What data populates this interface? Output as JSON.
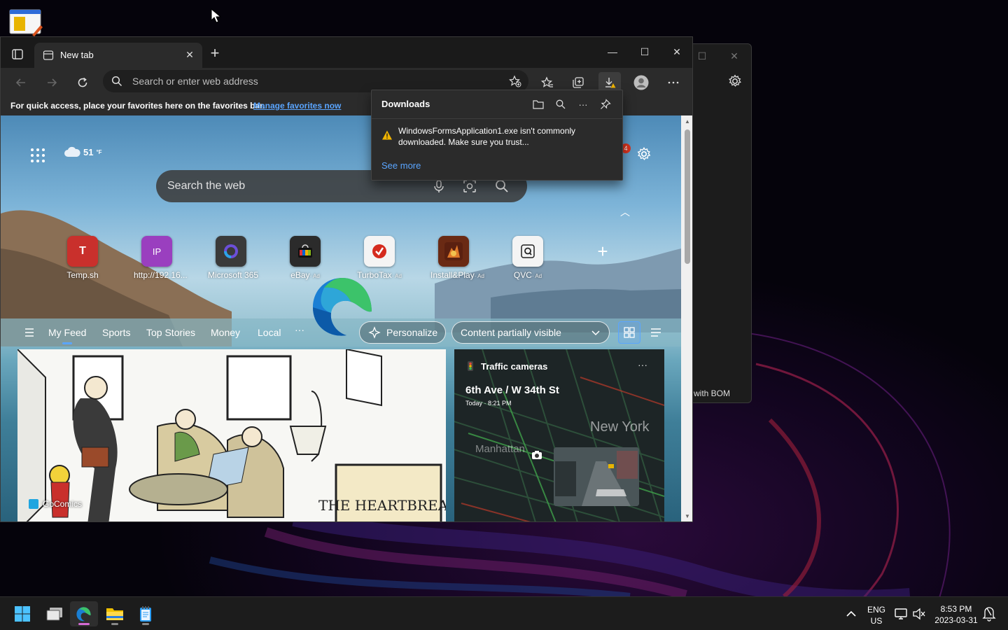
{
  "browser": {
    "tab_title": "New tab",
    "address_placeholder": "Search or enter web address",
    "favbar_message": "For quick access, place your favorites here on the favorites bar.",
    "favbar_link": "Manage favorites now"
  },
  "downloads": {
    "title": "Downloads",
    "message": "WindowsFormsApplication1.exe isn't commonly downloaded. Make sure you trust...",
    "see_more": "See more"
  },
  "newtab": {
    "weather_temp": "51",
    "weather_unit": "°F",
    "search_placeholder": "Search the web",
    "notification_count": "4",
    "quick_links": [
      {
        "label": "Temp.sh",
        "ad": "",
        "letter": "T",
        "color": "#c9302c"
      },
      {
        "label": "http://192.16...",
        "ad": "",
        "letter": "IP",
        "color": "#9a3fbf"
      },
      {
        "label": "Microsoft 365",
        "ad": "",
        "letter": "",
        "color": "#3a3a3a"
      },
      {
        "label": "eBay",
        "ad": "· Ad",
        "letter": "",
        "color": "#2b2b2b"
      },
      {
        "label": "TurboTax",
        "ad": "· Ad",
        "letter": "✔",
        "color": "#f4f4f4"
      },
      {
        "label": "Install&Play",
        "ad": "· Ad",
        "letter": "",
        "color": "#6a2a14"
      },
      {
        "label": "QVC",
        "ad": "· Ad",
        "letter": "Q",
        "color": "#f4f4f4"
      }
    ],
    "feed_nav": [
      "My Feed",
      "Sports",
      "Top Stories",
      "Money",
      "Local"
    ],
    "more_label": "···",
    "personalize": "Personalize",
    "content_visibility": "Content partially visible"
  },
  "cards": {
    "comic_source": "GoComics",
    "comic_sign": "THE HEARTBREAK",
    "traffic_title": "Traffic cameras",
    "traffic_street": "6th Ave / W 34th St",
    "traffic_time": "Today · 8:21 PM",
    "traffic_city": "New York",
    "traffic_area": "Manhattan"
  },
  "bg_window": {
    "text": "with BOM"
  },
  "taskbar": {
    "lang_top": "ENG",
    "lang_bottom": "US",
    "time": "8:53 PM",
    "date": "2023-03-31"
  },
  "colors": {
    "accent": "#5aa5ff",
    "taskbar_indicator": "#d46ad4",
    "warning": "#f0b400"
  }
}
